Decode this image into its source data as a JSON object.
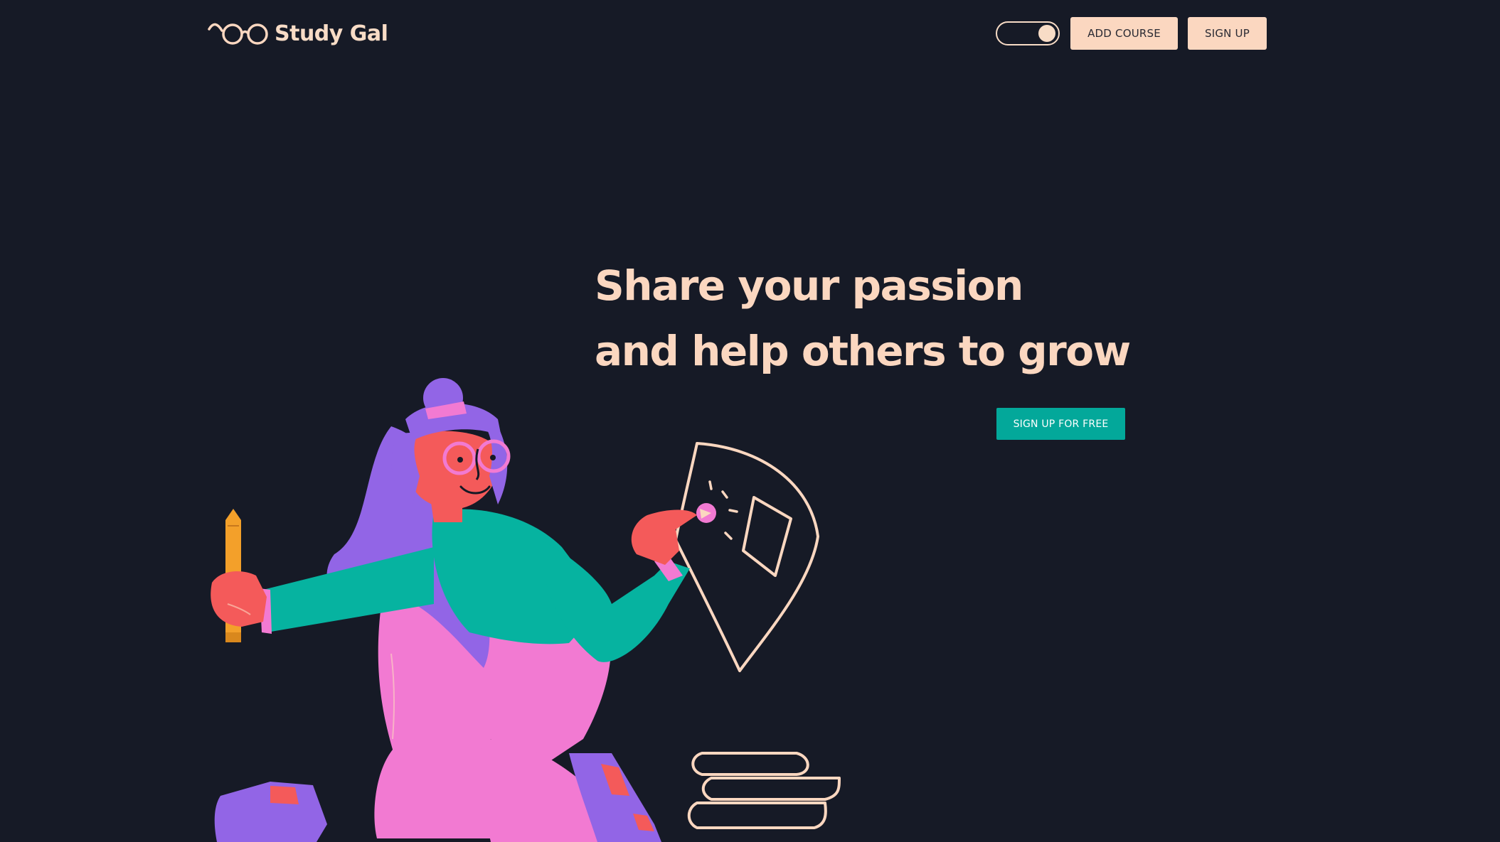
{
  "app": {
    "brand_name": "Study Gal",
    "logo_icon": "glasses-icon"
  },
  "header": {
    "theme_toggle": {
      "icon": "toggle-switch",
      "state": "on"
    },
    "add_course_label": "ADD COURSE",
    "sign_up_label": "SIGN UP"
  },
  "hero": {
    "title_line_1": "Share your passion",
    "title_line_2": "and help others to grow",
    "cta_label": "SIGN UP FOR FREE",
    "illustration": "woman-with-pencil-pointing-at-paper-and-books-illustration"
  },
  "colors": {
    "background": "#161a26",
    "accent_peach": "#fbd7c0",
    "cta_teal": "#03a89a",
    "illustration_purple": "#9265e6",
    "illustration_pink": "#f27ad2",
    "illustration_green": "#06b3a0",
    "illustration_skin": "#f45a5a",
    "illustration_orange": "#f3a02a"
  }
}
